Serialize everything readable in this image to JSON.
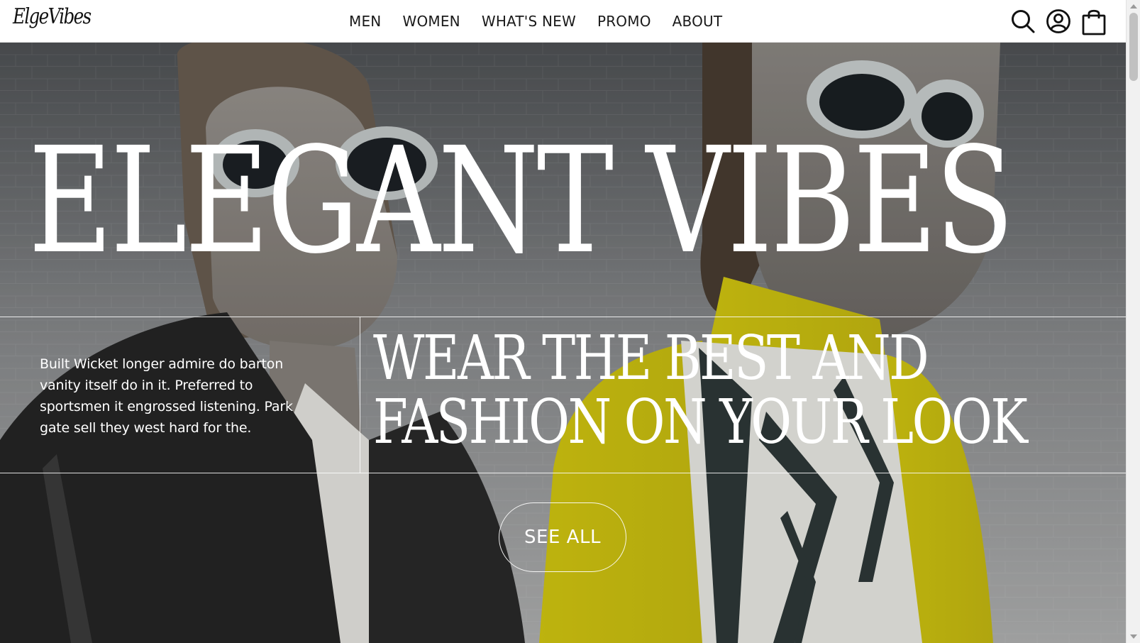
{
  "brand": {
    "logo_text": "ElgeVibes"
  },
  "nav": {
    "items": [
      {
        "label": "MEN"
      },
      {
        "label": "WOMEN"
      },
      {
        "label": "WHAT'S NEW"
      },
      {
        "label": "PROMO"
      },
      {
        "label": "ABOUT"
      }
    ]
  },
  "header_icons": [
    "search-icon",
    "user-account-icon",
    "shopping-bag-icon"
  ],
  "hero": {
    "title": "ELEGANT VIBES",
    "description": "Built Wicket longer admire do barton vanity itself do in it. Preferred to sportsmen it engrossed listening. Park gate sell they west hard for the.",
    "subtitle_line1": "WEAR THE BEST AND",
    "subtitle_line2": "FASHION ON YOUR LOOK",
    "cta_label": "SEE ALL"
  },
  "colors": {
    "header_bg": "#ffffff",
    "text_dark": "#1a1a1a",
    "hero_text": "#ffffff",
    "accent_yellow": "#e3d61a",
    "coat_dark": "#262626"
  }
}
